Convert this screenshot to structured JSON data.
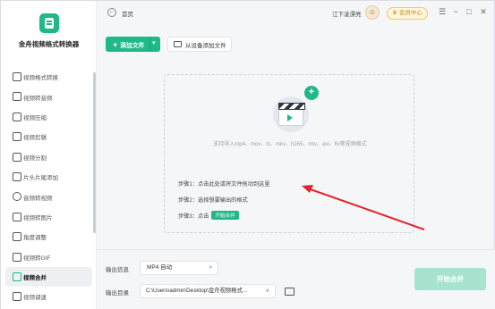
{
  "app": {
    "name": "金舟视频格式转换器"
  },
  "colors": {
    "accent": "#1fb888",
    "annotation": "#e0242b",
    "start_disabled": "#a8e3cf"
  },
  "sidebar": {
    "items": [
      {
        "label": "视频格式转换",
        "icon": "convert-icon"
      },
      {
        "label": "视频转音频",
        "icon": "audio-icon"
      },
      {
        "label": "视频压缩",
        "icon": "compress-icon"
      },
      {
        "label": "视频剪辑",
        "icon": "edit-icon"
      },
      {
        "label": "视频分割",
        "icon": "split-icon"
      },
      {
        "label": "片头片尾添加",
        "icon": "intro-outro-icon"
      },
      {
        "label": "音频转视频",
        "icon": "audio-to-video-icon"
      },
      {
        "label": "视频转图片",
        "icon": "image-icon"
      },
      {
        "label": "角度调整",
        "icon": "rotate-icon"
      },
      {
        "label": "视频转GIF",
        "icon": "gif-icon"
      },
      {
        "label": "视频合并",
        "icon": "merge-icon",
        "active": true
      },
      {
        "label": "视频调速",
        "icon": "speed-icon"
      }
    ]
  },
  "titlebar": {
    "back_glyph": "←",
    "breadcrumb": "首页",
    "username": "江下凌漂亮",
    "vip_label": "会员中心",
    "menu_glyph": "☰",
    "minimize_glyph": "−",
    "maximize_glyph": "□",
    "close_glyph": "✕"
  },
  "toolbar": {
    "add_plus": "+",
    "add_label": "添加文件",
    "add_caret": "▾",
    "device_label": "从设备添加文件"
  },
  "drop": {
    "plus": "+",
    "formats": "支持导入mp4、mov、ts、mkv、h265、mtv、avi、flv等视频格式",
    "step1": "步骤1：点击此处或将文件拖动到这里",
    "step2": "步骤2：选择想要输出的格式",
    "step3_prefix": "步骤3：点击",
    "step3_tag": "开始合并"
  },
  "bottom": {
    "format_label": "输出信息",
    "format_value": "MP4 自动",
    "format_arrow": ">",
    "dir_label": "输出目录",
    "dir_value": "C:\\Users\\admin\\Desktop\\金舟视频格式...",
    "dir_arrow": "∨",
    "start_label": "开始合并"
  }
}
